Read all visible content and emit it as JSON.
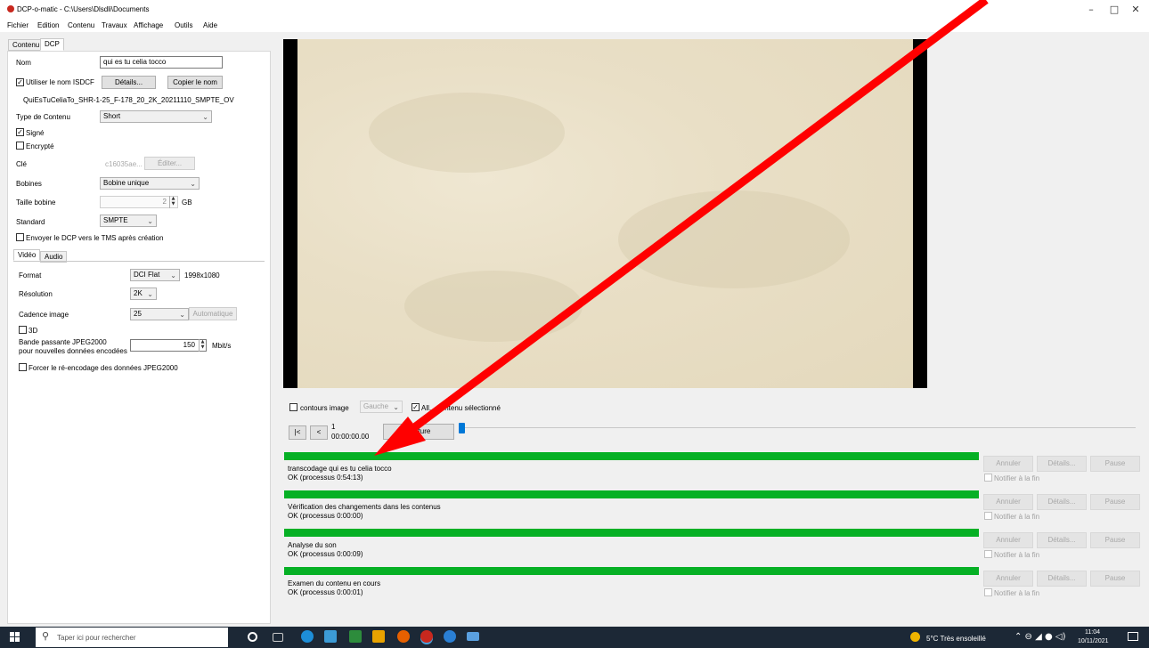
{
  "window": {
    "title": "DCP-o-matic - C:\\Users\\Dlsdli\\Documents",
    "controls": {
      "minimize": "–",
      "maximize": "□",
      "close": "✕"
    }
  },
  "menu": [
    "Fichier",
    "Edition",
    "Contenu",
    "Travaux",
    "Affichage",
    "Outils",
    "Aide"
  ],
  "top_tabs": [
    "Contenu",
    "DCP"
  ],
  "dcp": {
    "nom_label": "Nom",
    "nom_value": "qui es tu celia tocco",
    "isdcf_label": "Utiliser le nom ISDCF",
    "details_button": "Détails...",
    "copy_name_button": "Copier le nom",
    "isdcf_name": "QuiEsTuCeliaTo_SHR-1-25_F-178_20_2K_20211110_SMPTE_OV",
    "content_type_label": "Type de Contenu",
    "content_type_value": "Short",
    "signed_label": "Signé",
    "encrypted_label": "Encrypté",
    "key_label": "Clé",
    "key_value": "c16035ae...",
    "edit_button": "Éditer...",
    "reels_label": "Bobines",
    "reels_value": "Bobine unique",
    "reel_size_label": "Taille bobine",
    "reel_size_value": "2",
    "reel_size_unit": "GB",
    "standard_label": "Standard",
    "standard_value": "SMPTE",
    "send_tms_label": "Envoyer le DCP vers le TMS après création"
  },
  "sub_tabs": [
    "Vidéo",
    "Audio"
  ],
  "video": {
    "format_label": "Format",
    "format_value": "DCI Flat",
    "format_res": "1998x1080",
    "resolution_label": "Résolution",
    "resolution_value": "2K",
    "framerate_label": "Cadence image",
    "framerate_value": "25",
    "auto_button": "Automatique",
    "three_d_label": "3D",
    "bandwidth_label_1": "Bande passante JPEG2000",
    "bandwidth_label_2": "pour nouvelles données encodées",
    "bandwidth_value": "150",
    "bandwidth_unit": "Mbit/s",
    "force_reencode_label": "Forcer le ré-encodage des données JPEG2000"
  },
  "viewer": {
    "outline_label": "contours image",
    "eye_value": "Gauche",
    "all_content_label": "All... contenu sélectionné",
    "btn_start": "|<",
    "btn_prev": "<",
    "frame": "1",
    "timecode": "00:00:00.00",
    "play_button": "Lecture",
    "position": 0
  },
  "jobs": [
    {
      "title": "transcodage qui es tu celia tocco",
      "status": "OK (processus 0:54:13)",
      "progress": 1.0
    },
    {
      "title": "Vérification des changements dans les contenus",
      "status": "OK (processus 0:00:00)",
      "progress": 1.0
    },
    {
      "title": "Analyse du son",
      "status": "OK (processus 0:00:09)",
      "progress": 1.0
    },
    {
      "title": "Examen du contenu en cours",
      "status": "OK (processus 0:00:01)",
      "progress": 1.0
    }
  ],
  "job_buttons": {
    "cancel": "Annuler",
    "details": "Détails...",
    "pause": "Pause",
    "notify": "Notifier à la fin"
  },
  "annotation": {
    "color": "#ff0000"
  },
  "taskbar": {
    "search_placeholder": "Taper ici pour rechercher",
    "weather": "5°C  Très ensoleillé",
    "time": "11:04",
    "date": "10/11/2021"
  },
  "colors": {
    "progress": "#06b025",
    "accent": "#0078d7",
    "taskbar": "#1c2836"
  }
}
